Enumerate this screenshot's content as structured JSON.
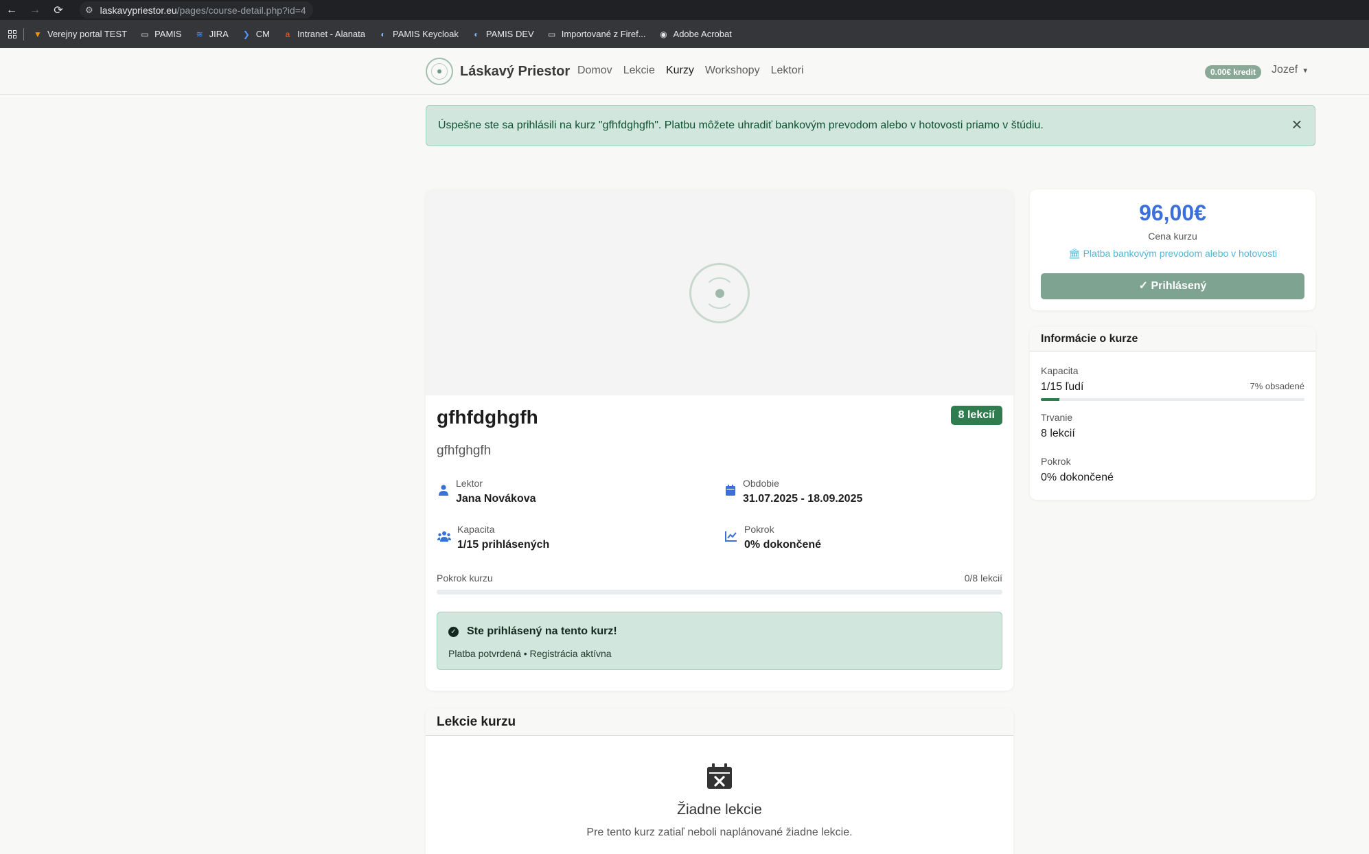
{
  "browser": {
    "url_host": "laskavypriestor.eu",
    "url_path": "/pages/course-detail.php?id=4",
    "bookmarks": [
      {
        "label": "Verejny portal TEST"
      },
      {
        "label": "PAMIS"
      },
      {
        "label": "JIRA"
      },
      {
        "label": "CM"
      },
      {
        "label": "Intranet - Alanata"
      },
      {
        "label": "PAMIS Keycloak"
      },
      {
        "label": "PAMIS DEV"
      },
      {
        "label": "Importované z Firef..."
      },
      {
        "label": "Adobe Acrobat"
      }
    ]
  },
  "navbar": {
    "brand": "Láskavý Priestor",
    "links": [
      "Domov",
      "Lekcie",
      "Kurzy",
      "Workshopy",
      "Lektori"
    ],
    "active_link": "Kurzy",
    "credit": "0.00€ kredit",
    "user": "Jozef"
  },
  "alert": {
    "message": "Úspešne ste sa prihlásili na kurz \"gfhfdghgfh\". Platbu môžete uhradiť bankovým prevodom alebo v hotovosti priamo v štúdiu."
  },
  "course": {
    "title": "gfhfdghgfh",
    "lessons_badge": "8 lekcií",
    "subtitle": "gfhfghgfh",
    "lektor_label": "Lektor",
    "lektor_value": "Jana Novákova",
    "obdobie_label": "Obdobie",
    "obdobie_value": "31.07.2025 - 18.09.2025",
    "kapacita_label": "Kapacita",
    "kapacita_value": "1/15 prihlásených",
    "pokrok_label": "Pokrok",
    "pokrok_value": "0% dokončené",
    "progress_label": "Pokrok kurzu",
    "progress_count": "0/8 lekcií",
    "progress_fraction": 0,
    "enrolled_title": "Ste prihlásený na tento kurz!",
    "enrolled_sub": "Platba potvrdená • Registrácia aktívna"
  },
  "lessons": {
    "header": "Lekcie kurzu",
    "empty_title": "Žiadne lekcie",
    "empty_sub": "Pre tento kurz zatiaľ neboli naplánované žiadne lekcie."
  },
  "price_card": {
    "price": "96,00€",
    "price_label": "Cena kurzu",
    "payment": "Platba bankovým prevodom alebo v hotovosti",
    "button": "Prihlásený"
  },
  "info_card": {
    "header": "Informácie o kurze",
    "kapacita_label": "Kapacita",
    "kapacita_value": "1/15 ľudí",
    "kapacita_pct": "7% obsadené",
    "kapacita_fraction": 0.07,
    "trvanie_label": "Trvanie",
    "trvanie_value": "8 lekcií",
    "pokrok_label": "Pokrok",
    "pokrok_value": "0% dokončené"
  },
  "colors": {
    "accent_blue": "#3b6fd9",
    "brand_green": "#7ea390",
    "badge_green": "#2f7d4f",
    "alert_bg": "#d1e7dd"
  }
}
